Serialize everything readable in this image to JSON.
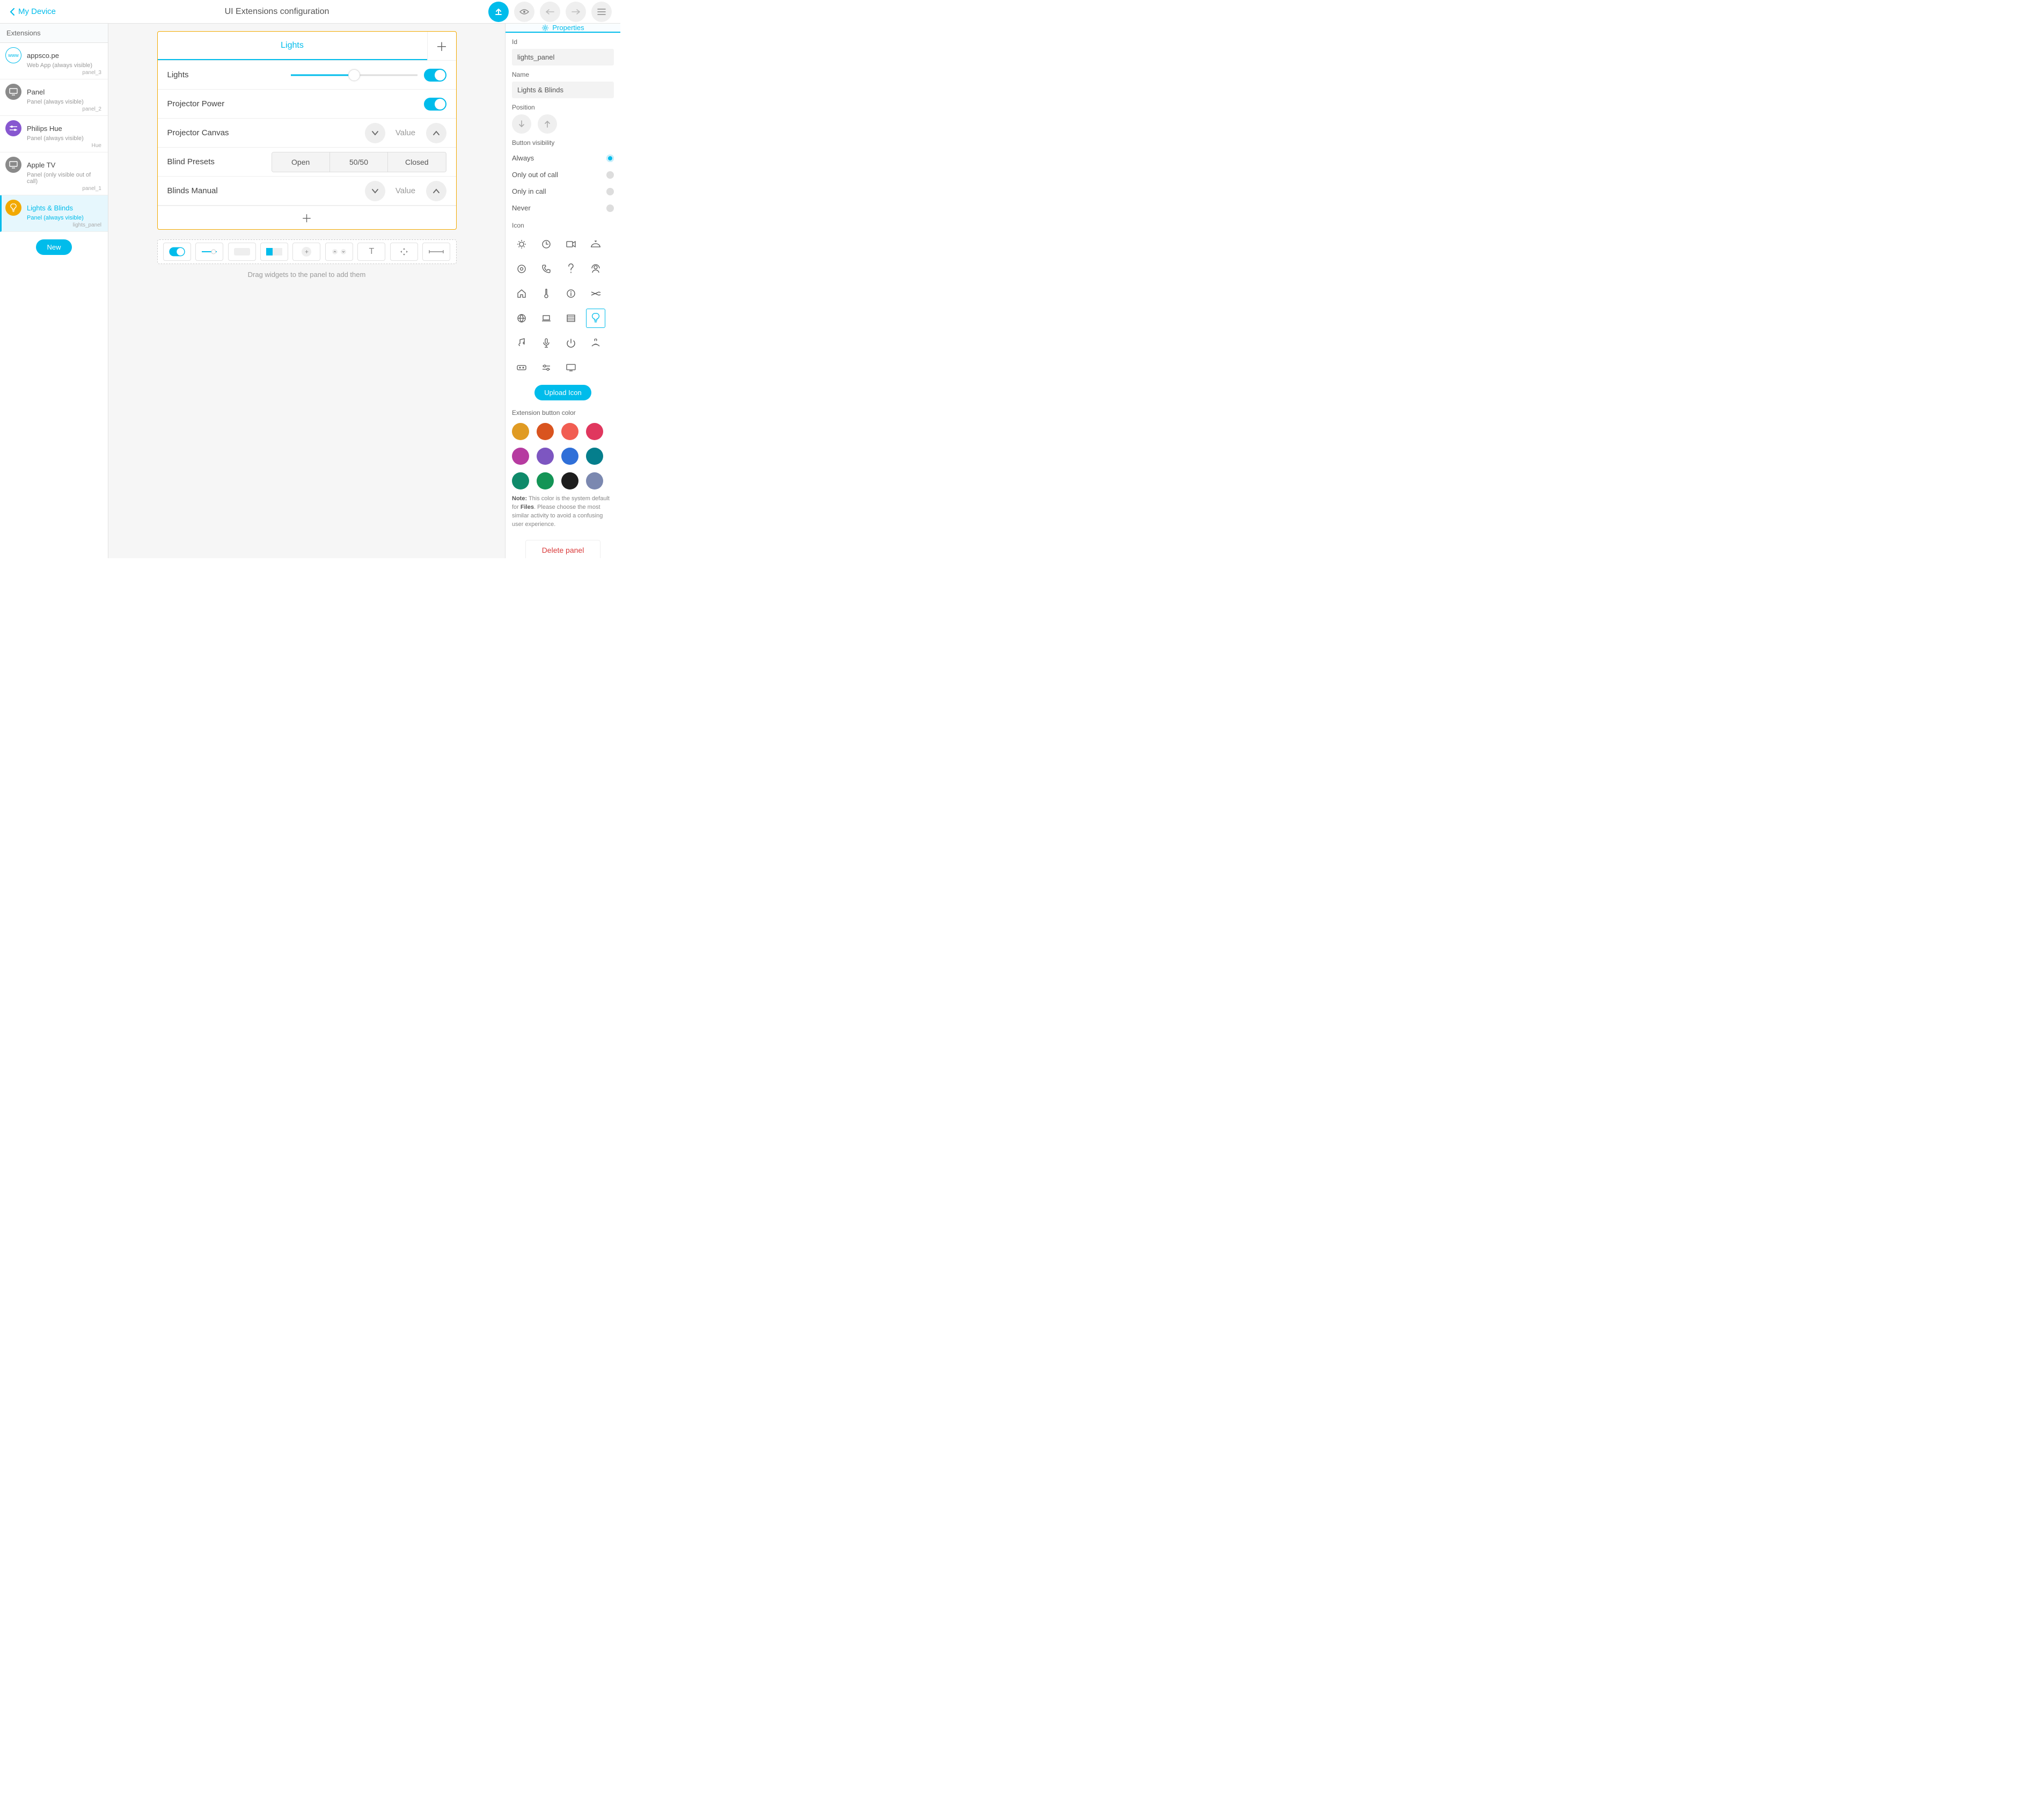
{
  "accent": "#00bceb",
  "header": {
    "back_label": "My Device",
    "title": "UI Extensions configuration"
  },
  "sidebar": {
    "heading": "Extensions",
    "new_label": "New",
    "items": [
      {
        "name": "appsco.pe",
        "sub": "Web App (always visible)",
        "id": "panel_3",
        "icon": "www",
        "icon_bg": "#ffffff",
        "icon_border": "#00bceb",
        "icon_color": "#00bceb"
      },
      {
        "name": "Panel",
        "sub": "Panel (always visible)",
        "id": "panel_2",
        "icon": "monitor",
        "icon_bg": "#8a8a8a"
      },
      {
        "name": "Philips Hue",
        "sub": "Panel (always visible)",
        "id": "Hue",
        "icon": "sliders",
        "icon_bg": "#8757d0"
      },
      {
        "name": "Apple TV",
        "sub": "Panel (only visible out of call)",
        "id": "panel_1",
        "icon": "monitor",
        "icon_bg": "#8a8a8a"
      },
      {
        "name": "Lights & Blinds",
        "sub": "Panel (always visible)",
        "id": "lights_panel",
        "icon": "lightbulb",
        "icon_bg": "#f2a900",
        "selected": true
      }
    ]
  },
  "panel": {
    "tab_label": "Lights",
    "rows": {
      "lights": {
        "label": "Lights"
      },
      "proj_pwr": {
        "label": "Projector Power"
      },
      "proj_cv": {
        "label": "Projector Canvas",
        "value": "Value"
      },
      "presets": {
        "label": "Blind Presets",
        "opts": [
          "Open",
          "50/50",
          "Closed"
        ]
      },
      "blinds": {
        "label": "Blinds Manual",
        "value": "Value"
      }
    }
  },
  "tray_note": "Drag widgets to the panel to add them",
  "properties": {
    "heading": "Properties",
    "id_label": "Id",
    "id_value": "lights_panel",
    "name_label": "Name",
    "name_value": "Lights & Blinds",
    "pos_label": "Position",
    "vis_label": "Button visibility",
    "vis_options": [
      "Always",
      "Only out of call",
      "Only in call",
      "Never"
    ],
    "vis_selected": 0,
    "icon_label": "Icon",
    "icon_selected": 15,
    "upload_label": "Upload Icon",
    "color_label": "Extension button color",
    "colors": [
      "#e09b23",
      "#d9541f",
      "#f15d52",
      "#e0375e",
      "#b63ba0",
      "#7d56c1",
      "#2f6fd8",
      "#057e8c",
      "#0f8a6a",
      "#149456",
      "#1d1d1d",
      "#7b88b0"
    ],
    "note_bold1": "Note:",
    "note_text1": " This color is the system default for ",
    "note_bold2": "Files",
    "note_text2": ". Please choose the most similar activity to avoid a confusing user experience.",
    "delete_label": "Delete panel"
  }
}
